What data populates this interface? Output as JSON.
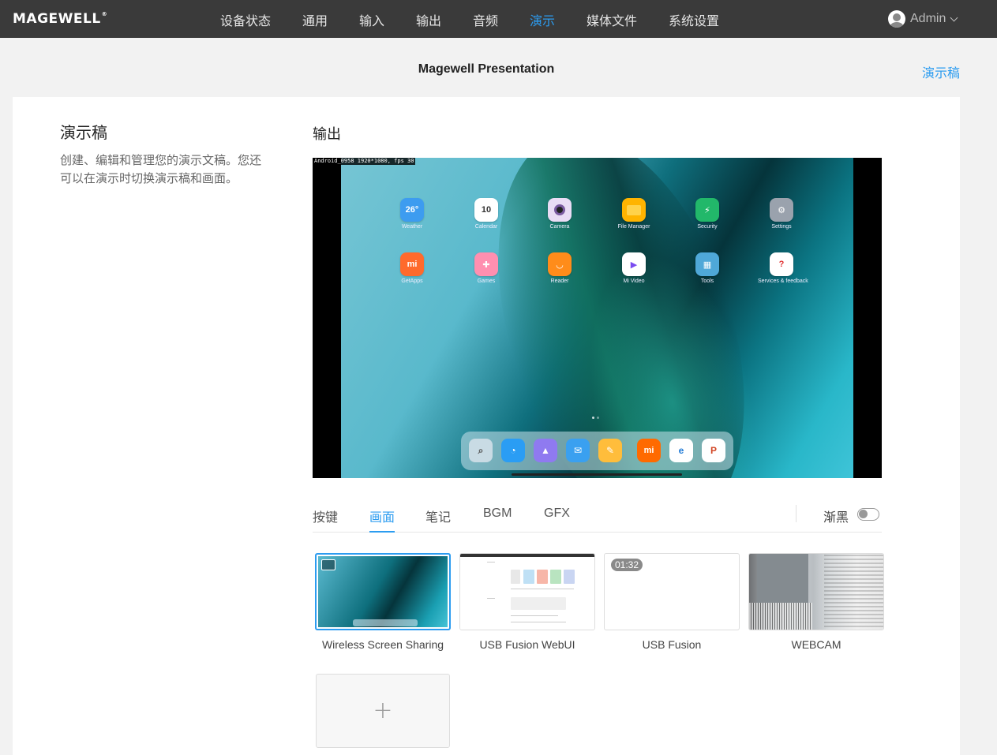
{
  "brand": {
    "name": "MAGEWELL",
    "mark": "®"
  },
  "nav": {
    "items": [
      {
        "label": "设备状态"
      },
      {
        "label": "通用"
      },
      {
        "label": "输入"
      },
      {
        "label": "输出"
      },
      {
        "label": "音频"
      },
      {
        "label": "演示"
      },
      {
        "label": "媒体文件"
      },
      {
        "label": "系统设置"
      }
    ],
    "active": "演示",
    "user": "Admin"
  },
  "header": {
    "title": "Magewell Presentation",
    "link": "演示稿"
  },
  "sidebar": {
    "title": "演示稿",
    "description": "创建、编辑和管理您的演示文稿。您还可以在演示时切换演示稿和画面。"
  },
  "output": {
    "title": "输出",
    "info": "Android_0958 1920*1080, fps 30",
    "apps": [
      {
        "label": "Weather",
        "icon": "weather-icon",
        "text": "26°",
        "color": "#3d9cf0"
      },
      {
        "label": "Calendar",
        "icon": "calendar-icon",
        "text": "10",
        "color": "#ffffff"
      },
      {
        "label": "Camera",
        "icon": "camera-icon",
        "text": "",
        "color": "#e9dcf5"
      },
      {
        "label": "File Manager",
        "icon": "folder-icon",
        "text": "",
        "color": "#ffb400"
      },
      {
        "label": "Security",
        "icon": "shield-icon",
        "text": "",
        "color": "#22b86a"
      },
      {
        "label": "Settings",
        "icon": "gear-icon",
        "text": "",
        "color": "#9aa2ad"
      },
      {
        "label": "GetApps",
        "icon": "getapps-icon",
        "text": "mi",
        "color": "#ff6a2c"
      },
      {
        "label": "Games",
        "icon": "gamepad-icon",
        "text": "",
        "color": "#ff8fb0"
      },
      {
        "label": "Reader",
        "icon": "reader-icon",
        "text": "",
        "color": "#ff8c1a"
      },
      {
        "label": "Mi Video",
        "icon": "play-icon",
        "text": "",
        "color": "#ffffff"
      },
      {
        "label": "Tools",
        "icon": "tools-icon",
        "text": "",
        "color": "#4fa8d8"
      },
      {
        "label": "Services & feedback",
        "icon": "feedback-icon",
        "text": "?",
        "color": "#ffffff"
      }
    ],
    "dock": [
      {
        "icon": "search-icon",
        "color": "#c9dbe4"
      },
      {
        "icon": "messages-icon",
        "color": "#2a9df4"
      },
      {
        "icon": "gallery-icon",
        "color": "#8f7af0"
      },
      {
        "icon": "mail-icon",
        "color": "#3aa0f0"
      },
      {
        "icon": "notes-icon",
        "color": "#ffbd3b"
      },
      {
        "icon": "mi-store-icon",
        "color": "#ff6a00"
      },
      {
        "icon": "edge-browser-icon",
        "color": "#ffffff"
      },
      {
        "icon": "powerpoint-icon",
        "color": "#ffffff"
      }
    ]
  },
  "tabs": {
    "items": [
      {
        "label": "按键"
      },
      {
        "label": "画面"
      },
      {
        "label": "笔记"
      },
      {
        "label": "BGM"
      },
      {
        "label": "GFX"
      }
    ],
    "active": "画面",
    "fade_label": "渐黑",
    "fade_on": false
  },
  "scenes": [
    {
      "label": "Wireless Screen Sharing",
      "selected": true
    },
    {
      "label": "USB Fusion WebUI",
      "selected": false
    },
    {
      "label": "USB Fusion",
      "badge": "01:32",
      "selected": false
    },
    {
      "label": "WEBCAM",
      "selected": false
    }
  ],
  "add_scene": {
    "icon": "plus-icon",
    "label": "+"
  },
  "colors": {
    "accent": "#2c9cf0",
    "topbar": "#3a3a3a"
  }
}
